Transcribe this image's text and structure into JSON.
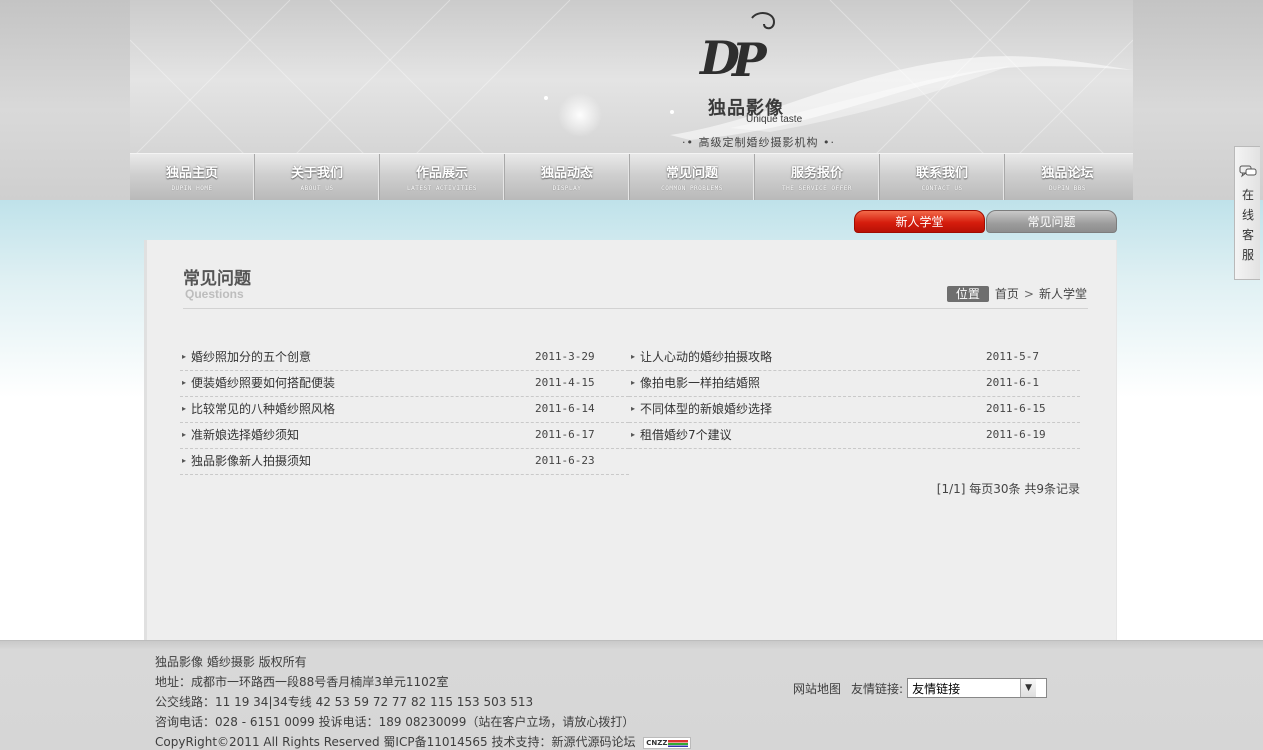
{
  "brand": {
    "logo_cn": "独品影像",
    "logo_en": "Unique taste",
    "tagline": "·• 高级定制婚纱摄影机构 •·"
  },
  "nav": [
    {
      "cn": "独品主页",
      "en": "DUPIN HOME"
    },
    {
      "cn": "关于我们",
      "en": "ABOUT US"
    },
    {
      "cn": "作品展示",
      "en": "LATEST ACTIVITIES"
    },
    {
      "cn": "独品动态",
      "en": "DISPLAY"
    },
    {
      "cn": "常见问题",
      "en": "COMMON PROBLEMS"
    },
    {
      "cn": "服务报价",
      "en": "THE SERVICE OFFER"
    },
    {
      "cn": "联系我们",
      "en": "CONTACT US"
    },
    {
      "cn": "独品论坛",
      "en": "DUPIN BBS"
    }
  ],
  "tabs": {
    "active": "新人学堂",
    "normal": "常见问题"
  },
  "section": {
    "title": "常见问题",
    "subtitle": "Questions"
  },
  "breadcrumb": {
    "label": "位置",
    "home": "首页",
    "sep": ">",
    "current": "新人学堂"
  },
  "articles_left": [
    {
      "title": "婚纱照加分的五个创意",
      "date": "2011-3-29"
    },
    {
      "title": "便装婚纱照要如何搭配便装",
      "date": "2011-4-15"
    },
    {
      "title": "比较常见的八种婚纱照风格",
      "date": "2011-6-14"
    },
    {
      "title": "准新娘选择婚纱须知",
      "date": "2011-6-17"
    },
    {
      "title": "独品影像新人拍摄须知",
      "date": "2011-6-23"
    }
  ],
  "articles_right": [
    {
      "title": "让人心动的婚纱拍摄攻略",
      "date": "2011-5-7"
    },
    {
      "title": "像拍电影一样拍结婚照",
      "date": "2011-6-1"
    },
    {
      "title": "不同体型的新娘婚纱选择",
      "date": "2011-6-15"
    },
    {
      "title": "租借婚纱7个建议",
      "date": "2011-6-19"
    }
  ],
  "pager": "[1/1] 每页30条 共9条记录",
  "footer": {
    "copyright_line": "独品影像 婚纱摄影 版权所有",
    "address": "地址：成都市一环路西一段88号香月楠岸3单元1102室",
    "bus": "公交线路：11 19 34|34专线 42 53 59 72 77 82 115 153 503 513",
    "phone": "咨询电话：028 - 6151 0099 投诉电话：189 08230099（站在客户立场，请放心拨打）",
    "icp": "CopyRight©2011 All Rights Reserved 蜀ICP备11014565 技术支持：新源代源码论坛",
    "cnzz": "CNZZ",
    "sitemap": "网站地图",
    "friend_label": "友情链接:",
    "friend_select": "友情链接"
  },
  "kefu": "在线客服",
  "colors": {
    "accent_red": "#d61d0d",
    "tab_grey": "#9c9c9c",
    "panel_bg": "#eeeeee",
    "footer_bg": "#d6d6d6"
  }
}
